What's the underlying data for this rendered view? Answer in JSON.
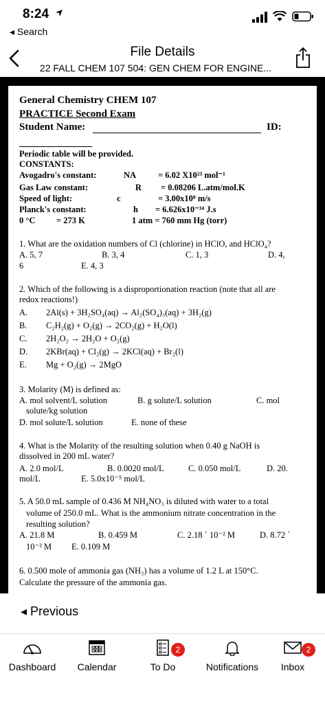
{
  "status_bar": {
    "time": "8:24",
    "back_label": "Search"
  },
  "header": {
    "title": "File Details",
    "subtitle": "22 FALL CHEM 107 504: GEN CHEM FOR ENGINE..."
  },
  "document": {
    "course": "General Chemistry CHEM 107",
    "exam": "PRACTICE Second Exam",
    "student_name_label": "Student Name:",
    "id_label": "ID:",
    "periodic": "Periodic table will be provided.",
    "constants_label": "CONSTANTS:",
    "constants": {
      "avogadro_label": "Avogadro's constant:",
      "avogadro_symbol": "NA",
      "avogadro_value": "= 6.02 X10²³ mol⁻¹",
      "gas_label": "Gas Law constant:",
      "gas_symbol": "R",
      "gas_value": "= 0.08206 L.atm/mol.K",
      "light_label": "Speed of light:",
      "light_symbol": "c",
      "light_value": "= 3.00x10⁸ m/s",
      "planck_label": "Planck's constant:",
      "planck_symbol": "h",
      "planck_value": "= 6.626x10⁻³⁴ J.s",
      "zero_c": "0 °C",
      "zero_k": "= 273 K",
      "atm": "1 atm = 760 mm Hg (torr)"
    },
    "q1": {
      "text": "1. What are the oxidation numbers of Cl (chlorine) in HClO, and HClO₄?",
      "a": "A. 5, 7",
      "b": "B. 3, 4",
      "c": "C. 1, 3",
      "d": "D. 4,",
      "cont": "6",
      "e": "E. 4, 3"
    },
    "q2": {
      "text1": "2. Which of the following is a disproportionation reaction (note that all are",
      "text2": "redox reactions!)",
      "a_l": "A.",
      "a": "2Al(s) + 3H₂SO₄(aq) → Al₂(SO₄)₃(aq) + 3H₂(g)",
      "b_l": "B.",
      "b": "C₂H₂(g) + O₂(g) → 2CO₂(g) + H₂O(l)",
      "c_l": "C.",
      "c": "2H₂O₂ → 2H₂O + O₂(g)",
      "d_l": "D.",
      "d": "2KBr(aq) + Cl₂(g) → 2KCl(aq) + Br₂(l)",
      "e_l": "E.",
      "e": "Mg + O₂(g) → 2MgO"
    },
    "q3": {
      "text": "3. Molarity (M) is defined as:",
      "a": "A. mol solvent/L solution",
      "b": "B. g solute/L solution",
      "c": "C. mol",
      "cont": "solute/kg solution",
      "d": "D. mol solute/L solution",
      "e": "E. none of these"
    },
    "q4": {
      "text1": "4. What is the Molarity of the resulting solution when 0.40 g NaOH is",
      "text2": "dissolved in 200 mL water?",
      "a": "A. 2.0 mol/L",
      "b": "B. 0.0020 mol/L",
      "c": "C. 0.050 mol/L",
      "d": "D. 20.",
      "cont": "mol/L",
      "e": "E. 5.0x10⁻⁵ mol/L"
    },
    "q5": {
      "text1": "5. A 50.0 mL sample of 0.436 M NH₄NO₃ is diluted with water to a total",
      "text2": "volume of 250.0 mL. What is the ammonium nitrate concentration in the",
      "text3": "resulting solution?",
      "a": "A. 21.8 M",
      "b": "B. 0.459 M",
      "c": "C. 2.18 ´ 10⁻² M",
      "d": "D. 8.72 ´",
      "cont": "10⁻² M",
      "e": "E. 0.109 M"
    },
    "q6": {
      "text1": "6. 0.500 mole of ammonia gas (NH₃) has a volume of 1.2 L at 150°C.",
      "text2": "Calculate the pressure of the ammonia gas."
    }
  },
  "previous_label": "Previous",
  "tabs": [
    {
      "label": "Dashboard"
    },
    {
      "label": "Calendar"
    },
    {
      "label": "To Do",
      "badge": "2"
    },
    {
      "label": "Notifications"
    },
    {
      "label": "Inbox",
      "badge": "2"
    }
  ]
}
